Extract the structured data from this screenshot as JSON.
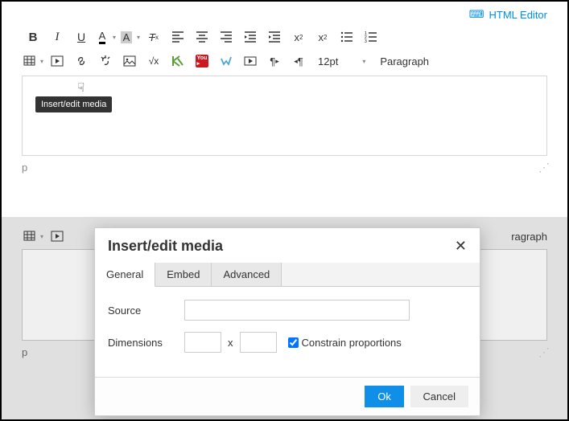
{
  "header": {
    "html_editor_label": "HTML Editor"
  },
  "toolbar": {
    "font_size": "12pt",
    "block_format": "Paragraph"
  },
  "status_path": "p",
  "tooltip": "Insert/edit media",
  "modal": {
    "title": "Insert/edit media",
    "tabs": {
      "general": "General",
      "embed": "Embed",
      "advanced": "Advanced"
    },
    "fields": {
      "source_label": "Source",
      "dimensions_label": "Dimensions",
      "constrain_label": "Constrain proportions",
      "dim_sep": "x"
    },
    "buttons": {
      "ok": "Ok",
      "cancel": "Cancel"
    }
  },
  "gray": {
    "block_format": "ragraph",
    "status_path": "p"
  }
}
